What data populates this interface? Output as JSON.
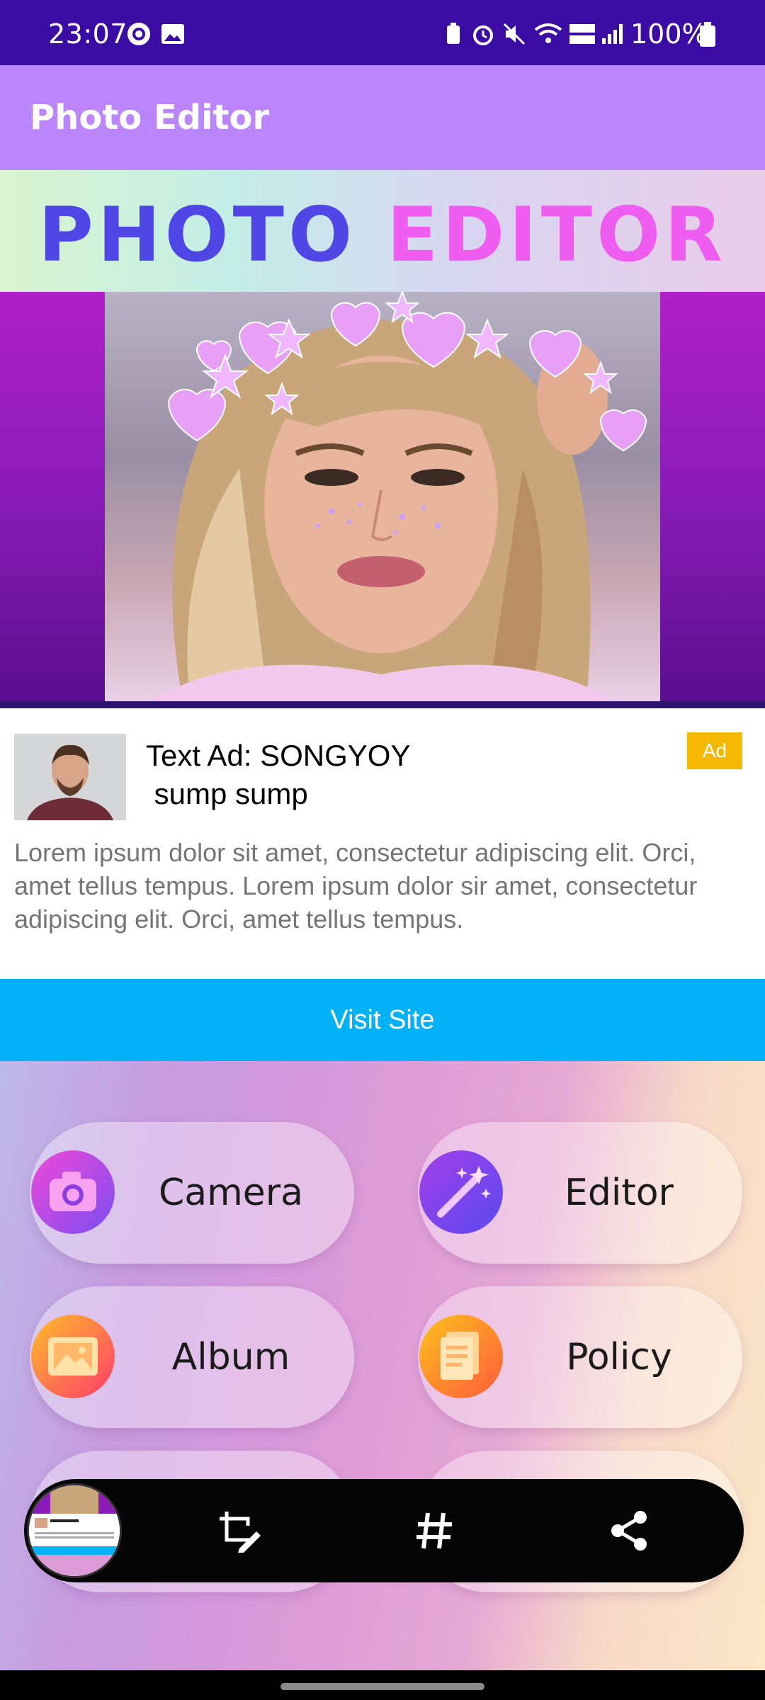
{
  "status_bar": {
    "time": "23:07",
    "battery": "100%"
  },
  "app_bar": {
    "title": "Photo Editor"
  },
  "banner": {
    "word1": "PHOTO",
    "word2": "EDITOR"
  },
  "ad": {
    "title": "Text Ad: SONGYOY\n sump sump",
    "badge": "Ad",
    "body": "Lorem ipsum dolor sit amet, consectetur adipiscing elit. Orci, amet tellus tempus. Lorem ipsum dolor sir amet, consectetur adipiscing elit. Orci, amet tellus tempus.",
    "button": "Visit Site"
  },
  "menu": [
    {
      "label": "Camera",
      "icon": "camera-icon"
    },
    {
      "label": "Editor",
      "icon": "magic-wand-icon"
    },
    {
      "label": "Album",
      "icon": "image-icon"
    },
    {
      "label": "Policy",
      "icon": "document-icon"
    }
  ],
  "float_toolbar": {
    "icons": [
      "crop-edit-icon",
      "hashtag-icon",
      "share-icon"
    ]
  },
  "colors": {
    "status_bar": "#3a0ca3",
    "app_bar": "#bb86fc",
    "visit_button": "#03b1f7",
    "ad_badge": "#f5b800"
  }
}
